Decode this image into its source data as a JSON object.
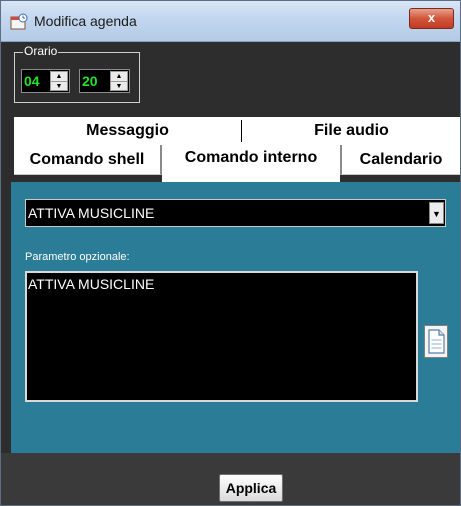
{
  "window": {
    "title": "Modifica agenda",
    "close_label": "x"
  },
  "orario": {
    "legend": "Orario",
    "hours": "04",
    "minutes": "20"
  },
  "tabs": {
    "row_back": [
      "Messaggio",
      "File audio"
    ],
    "row_front": [
      "Comando shell",
      "Comando interno",
      "Calendario"
    ],
    "selected": "Comando interno"
  },
  "command": {
    "selected_value": "ATTIVA MUSICLINE"
  },
  "parameter": {
    "label": "Parametro opzionale:",
    "value": "ATTIVA MUSICLINE"
  },
  "footer": {
    "apply_label": "Applica"
  },
  "colors": {
    "panel": "#2b7c97",
    "background": "#2d2d2d",
    "time_digits": "#24e22a"
  },
  "icons": {
    "app": "calendar-icon",
    "spin_up": "spin-up-icon",
    "spin_down": "spin-down-icon",
    "dropdown": "chevron-down-icon",
    "document": "document-icon"
  }
}
